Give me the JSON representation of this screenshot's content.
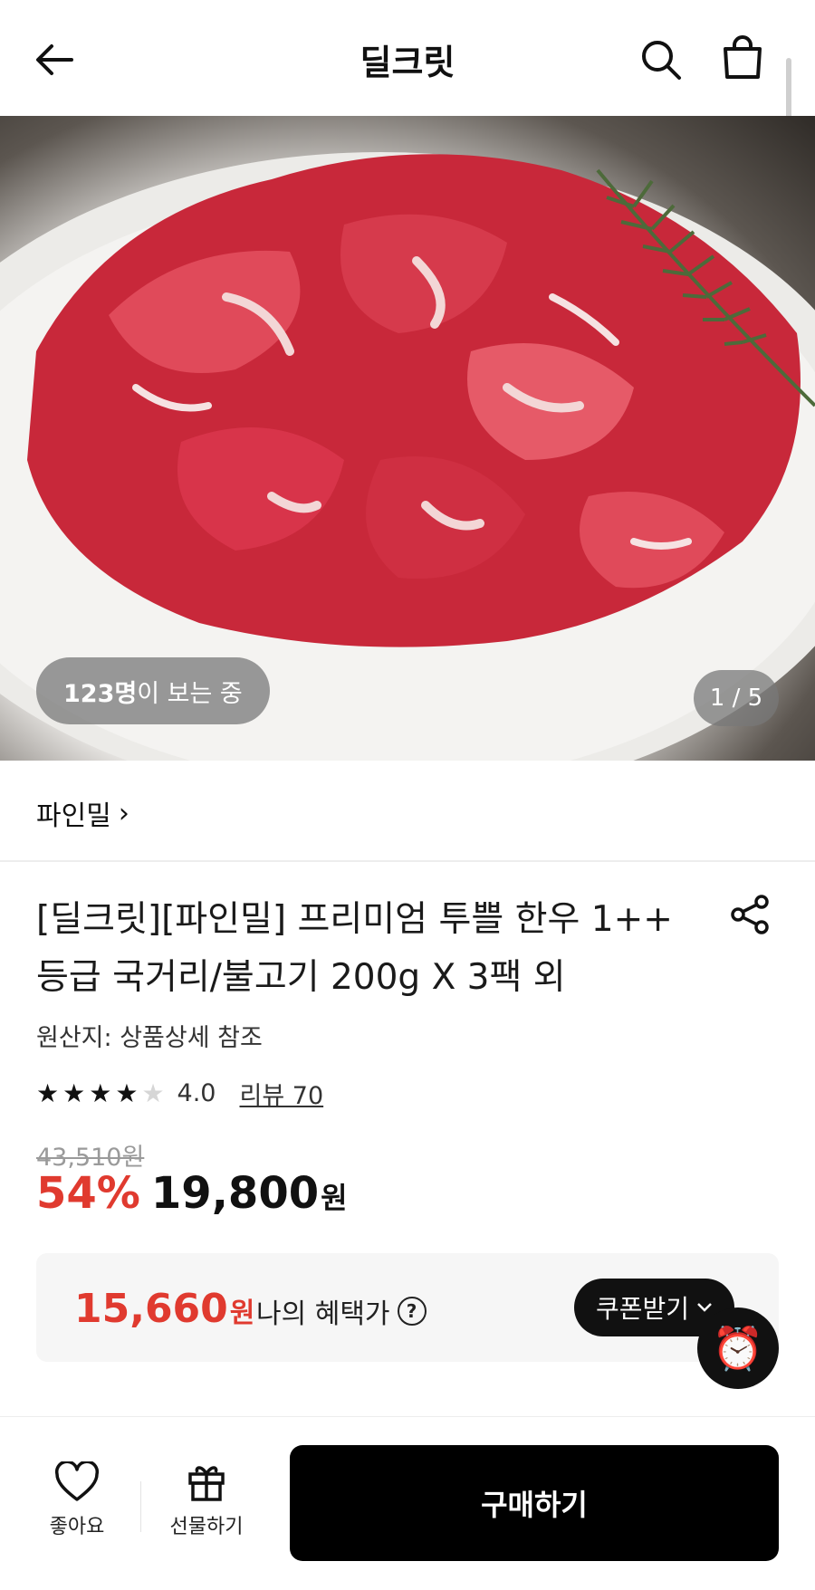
{
  "header": {
    "title": "딜크릿",
    "back_icon": "arrow-left-icon",
    "search_icon": "search-icon",
    "bag_icon": "shopping-bag-icon"
  },
  "hero": {
    "viewers_count": "123명",
    "viewers_suffix": "이 보는 중",
    "page_indicator": "1 / 5"
  },
  "seller": {
    "name": "파인밀",
    "chevron": "›"
  },
  "product": {
    "title": "[딜크릿][파인밀] 프리미엄 투쁠 한우 1++ 등급 국거리/불고기 200g X 3팩 외",
    "origin": "원산지: 상품상세 참조",
    "rating": 4.0,
    "rating_text": "4.0",
    "review_link": "리뷰 70",
    "original_price": "43,510원",
    "discount": "54%",
    "price": "19,800",
    "price_unit": "원"
  },
  "benefit": {
    "price": "15,660",
    "price_unit": "원",
    "label": "나의 혜택가",
    "help": "?",
    "coupon_button": "쿠폰받기",
    "alarm_icon": "⏰"
  },
  "bottom_bar": {
    "like_label": "좋아요",
    "gift_label": "선물하기",
    "buy_label": "구매하기"
  },
  "colors": {
    "accent_red": "#e03a2f",
    "dark": "#111111",
    "benefit_bg": "#f6f6f6"
  }
}
